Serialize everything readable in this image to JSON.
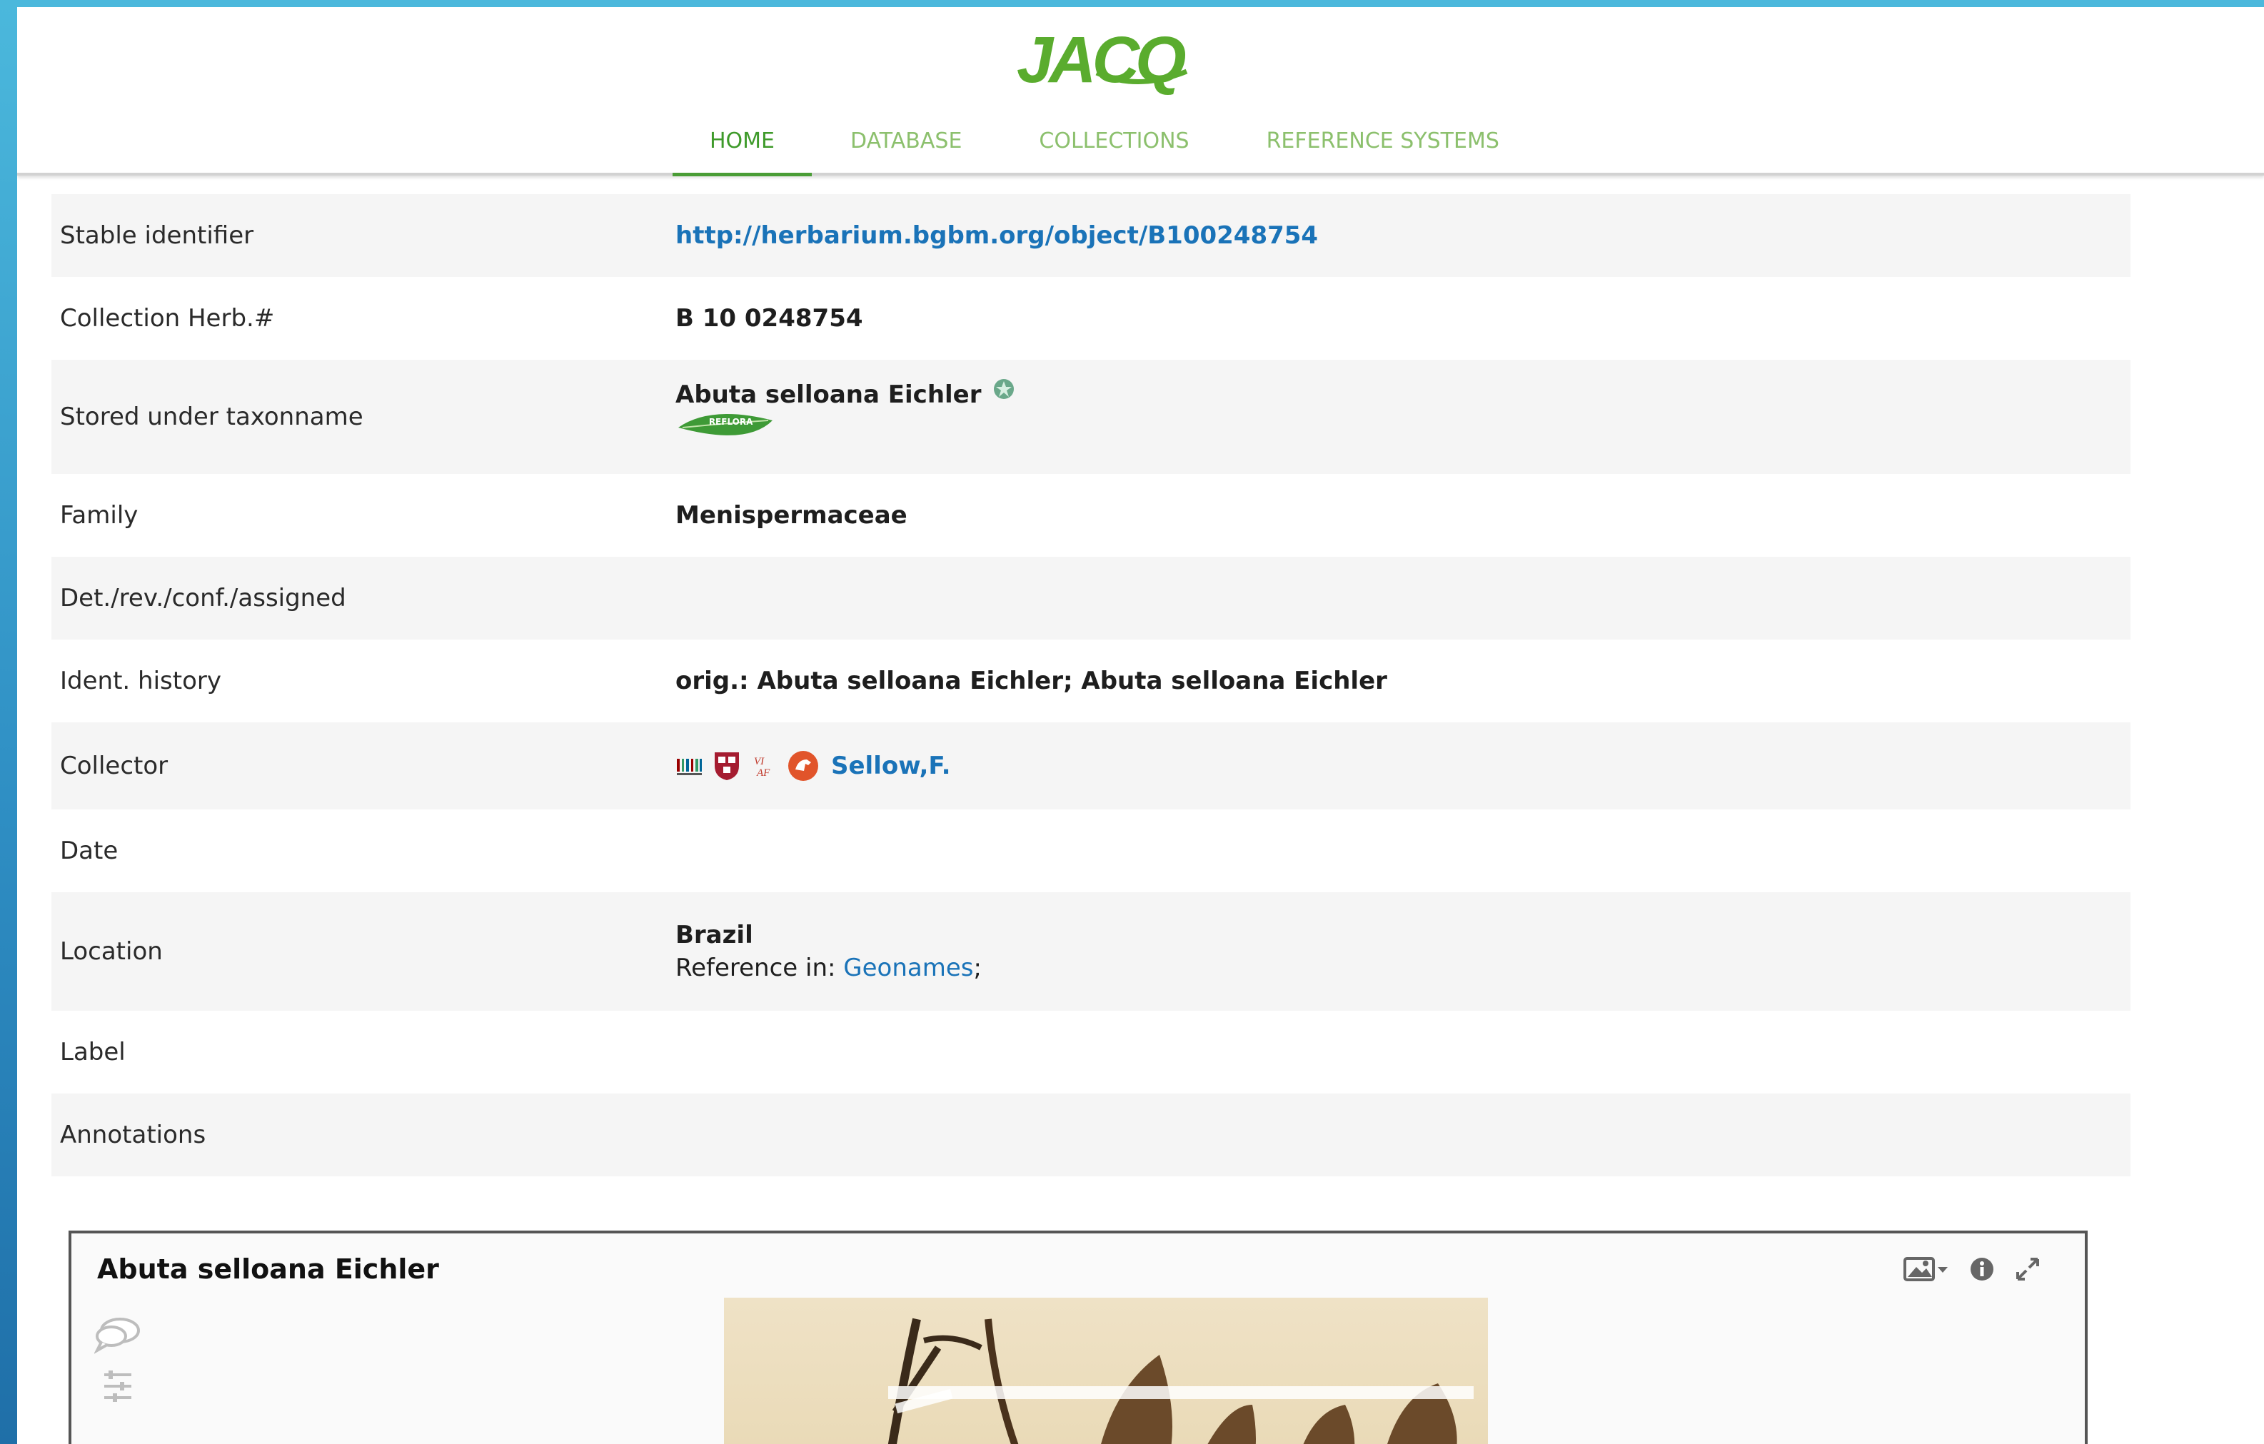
{
  "header": {
    "logo_text": "JACQ",
    "brand_color": "#5aac2e",
    "nav": [
      {
        "label": "HOME",
        "active": true
      },
      {
        "label": "DATABASE",
        "active": false
      },
      {
        "label": "COLLECTIONS",
        "active": false
      },
      {
        "label": "REFERENCE SYSTEMS",
        "active": false
      }
    ]
  },
  "record": {
    "stable_identifier": {
      "label": "Stable identifier",
      "value": "http://herbarium.bgbm.org/object/B100248754"
    },
    "collection_herb": {
      "label": "Collection Herb.#",
      "value": "B 10 0248754"
    },
    "taxonname": {
      "label": "Stored under taxonname",
      "value": "Abuta selloana Eichler",
      "badge_text": "REFLORA"
    },
    "family": {
      "label": "Family",
      "value": "Menispermaceae"
    },
    "det": {
      "label": "Det./rev./conf./assigned",
      "value": ""
    },
    "ident_history": {
      "label": "Ident. history",
      "value": "orig.: Abuta selloana Eichler; Abuta selloana Eichler"
    },
    "collector": {
      "label": "Collector",
      "value": "Sellow,F.",
      "icons": [
        "wikidata-barcode-icon",
        "harvard-shield-icon",
        "viaf-icon",
        "bloodhound-icon"
      ]
    },
    "date": {
      "label": "Date",
      "value": ""
    },
    "location": {
      "label": "Location",
      "country": "Brazil",
      "reference_prefix": "Reference in: ",
      "reference_link": "Geonames",
      "reference_suffix": ";"
    },
    "label_field": {
      "label": "Label",
      "value": ""
    },
    "annotations": {
      "label": "Annotations",
      "value": ""
    }
  },
  "viewer": {
    "title": "Abuta selloana Eichler",
    "tools": [
      "image-select-icon",
      "info-icon",
      "fullscreen-icon"
    ],
    "side_tools": [
      "comment-icon",
      "adjust-sliders-icon"
    ]
  }
}
